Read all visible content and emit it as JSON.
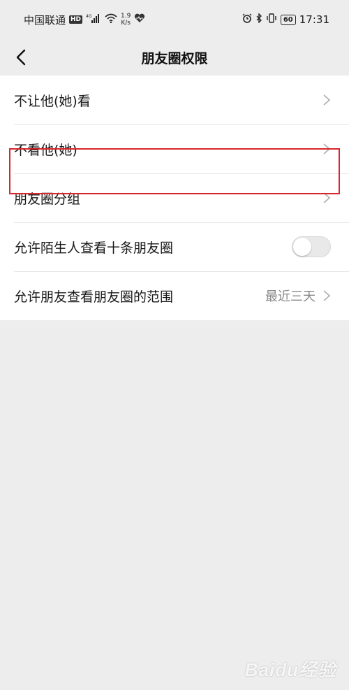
{
  "statusbar": {
    "carrier": "中国联通",
    "hd": "HD",
    "network": "4G",
    "speed_value": "1.9",
    "speed_unit": "K/s",
    "battery": "60",
    "time": "17:31"
  },
  "navbar": {
    "title": "朋友圈权限"
  },
  "settings": [
    {
      "label": "不让他(她)看"
    },
    {
      "label": "不看他(她)"
    },
    {
      "label": "朋友圈分组"
    },
    {
      "label": "允许陌生人查看十条朋友圈",
      "toggle_on": false
    },
    {
      "label": "允许朋友查看朋友圈的范围",
      "value": "最近三天"
    }
  ],
  "watermark": "Baidu经验",
  "colors": {
    "background": "#ededed",
    "highlight": "#d9262c",
    "toggle_off": "#e9e9e9"
  }
}
